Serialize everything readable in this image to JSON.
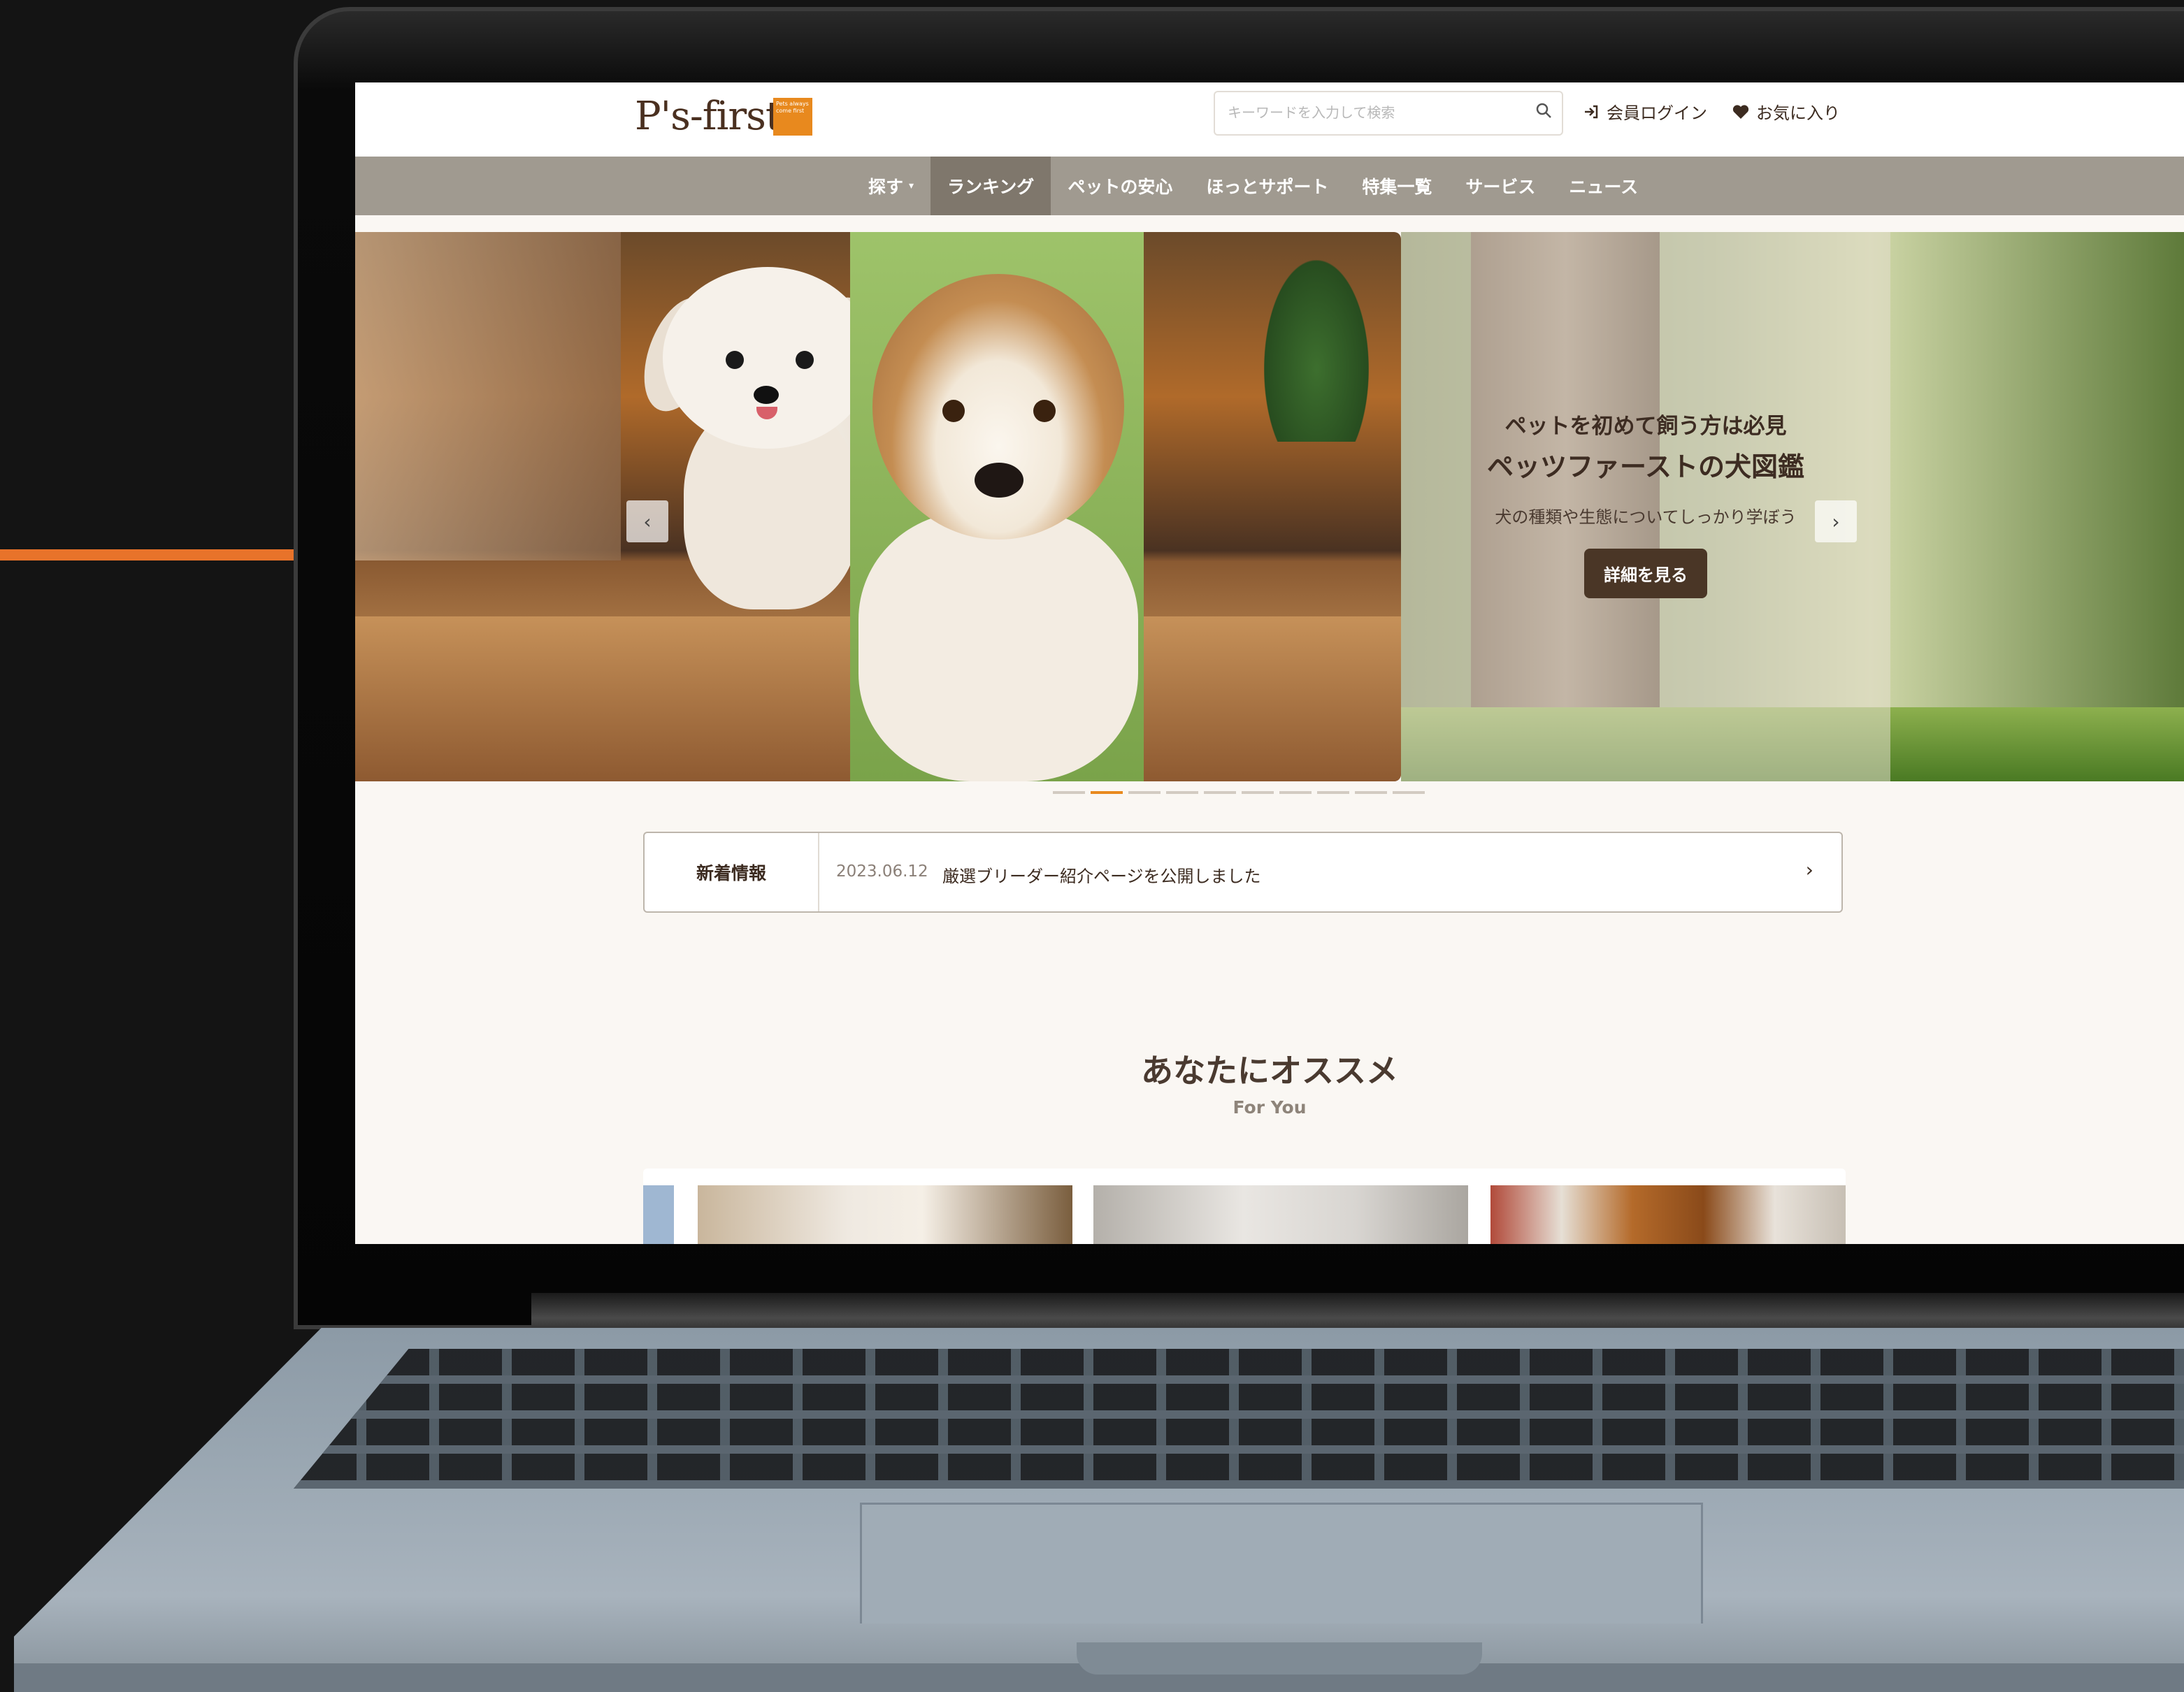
{
  "site": {
    "logo_text": "P's-first",
    "logo_badge": "Pets always come first"
  },
  "header": {
    "search_placeholder": "キーワードを入力して検索",
    "login_label": "会員ログイン",
    "favorites_label": "お気に入り"
  },
  "nav": {
    "items": [
      {
        "label": "探す",
        "has_dropdown": true,
        "active": false
      },
      {
        "label": "ランキング",
        "active": true
      },
      {
        "label": "ペットの安心",
        "active": false
      },
      {
        "label": "ほっとサポート",
        "active": false
      },
      {
        "label": "特集一覧",
        "active": false
      },
      {
        "label": "サービス",
        "active": false
      },
      {
        "label": "ニュース",
        "active": false
      }
    ]
  },
  "hero": {
    "subtitle": "ペットを初めて飼う方は必見",
    "title": "ペッツファーストの犬図鑑",
    "description": "犬の種類や生態についてしっかり学ぼう",
    "button_label": "詳細を見る",
    "prev_icon": "‹",
    "next_icon": "›",
    "slide_count": 10,
    "active_slide": 2
  },
  "news": {
    "label": "新着情報",
    "date": "2023.06.12",
    "text": "厳選ブリーダー紹介ページを公開しました",
    "arrow": "›"
  },
  "recommend": {
    "title": "あなたにオススメ",
    "subtitle": "For You"
  },
  "colors": {
    "accent": "#e8891e",
    "nav_bg": "#a09a90",
    "nav_active": "#7f776c",
    "button_dark": "#4a3626",
    "page_bg": "#faf7f3",
    "side_accent": "#e8732a"
  }
}
